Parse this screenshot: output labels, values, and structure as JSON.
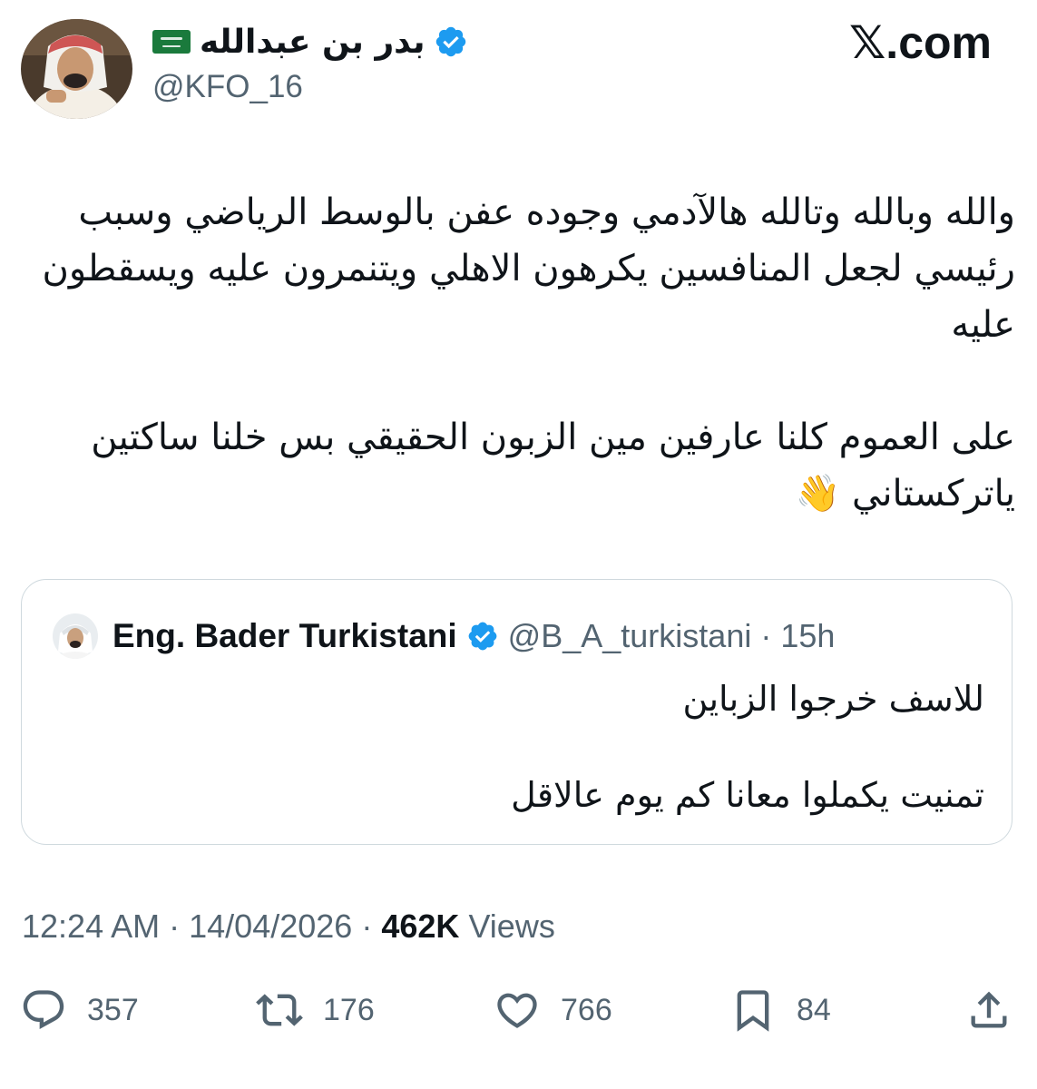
{
  "header": {
    "display_name": "بدر بن عبدالله",
    "handle": "@KFO_16",
    "site_logo_text": ".com",
    "site_logo_mark": "𝕏"
  },
  "tweet": {
    "paragraph_1": "والله وبالله وتالله هالآدمي وجوده عفن بالوسط الرياضي وسبب رئيسي لجعل المنافسين يكرهون الاهلي ويتنمرون عليه ويسقطون عليه",
    "paragraph_2": "على العموم كلنا عارفين مين الزبون الحقيقي بس خلنا ساكتين ياتركستاني 👋"
  },
  "quoted_tweet": {
    "author_name": "Eng. Bader Turkistani",
    "author_handle": "@B_A_turkistani",
    "separator": "·",
    "time_ago": "15h",
    "line_1": "للاسف خرجوا الزباين",
    "line_2": "تمنيت يكملوا معانا كم يوم عالاقل"
  },
  "meta": {
    "time": "12:24 AM",
    "separator": "·",
    "date": "14/04/2026",
    "views_count": "462K",
    "views_label": "Views"
  },
  "actions": {
    "replies": "357",
    "reposts": "176",
    "likes": "766",
    "bookmarks": "84"
  },
  "colors": {
    "verified_blue": "#1d9bf0",
    "secondary_text": "#536471",
    "primary_text": "#0f1419",
    "border": "#cfd9de"
  }
}
